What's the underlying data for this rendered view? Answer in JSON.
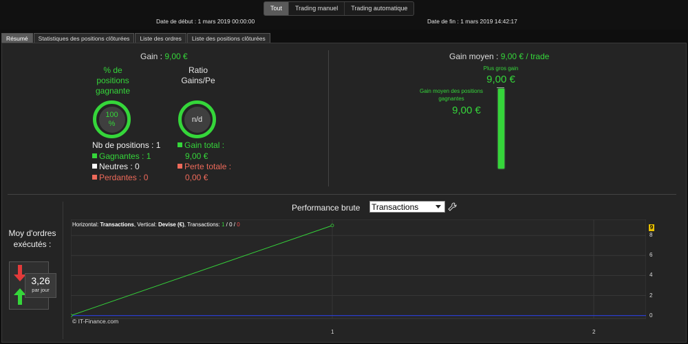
{
  "mode_tabs": [
    "Tout",
    "Trading manuel",
    "Trading automatique"
  ],
  "date_start": "Date de début : 1 mars 2019 00:00:00",
  "date_end": "Date de fin : 1 mars 2019 14:42:17",
  "section_tabs": [
    "Résumé",
    "Statistiques des positions clôturées",
    "Liste des ordres",
    "Liste des positions clôturées"
  ],
  "summary": {
    "gain_label": "Gain :",
    "gain_value": "9,00 €",
    "pct_title": "% de positions gagnante",
    "pct_value": "100 %",
    "ratio_title": "Ratio Gains/Pe",
    "ratio_value": "n/d",
    "nb_positions": "Nb de positions : 1",
    "winners": "Gagnantes : 1",
    "neutrals": "Neutres : 0",
    "losers": "Perdantes : 0",
    "total_gain_label": "Gain total :",
    "total_gain_value": "9,00 €",
    "total_loss_label": "Perte totale :",
    "total_loss_value": "0,00 €",
    "colors": {
      "win": "#35d63a",
      "neutral": "#ffffff",
      "loss": "#ee6a5a"
    }
  },
  "avg_gain": {
    "label": "Gain moyen :",
    "value": "9,00 € / trade",
    "biggest_label": "Plus gros gain",
    "biggest_value": "9,00 €",
    "avg_win_label": "Gain moyen des positions gagnantes",
    "avg_win_value": "9,00 €"
  },
  "orders": {
    "title": "Moy d'ordres exécutés :",
    "value": "3,26",
    "unit": "par jour"
  },
  "performance": {
    "title": "Performance brute",
    "select_value": "Transactions",
    "info_prefix_h": "Horizontal: ",
    "info_h": "Transactions",
    "info_mid": ", Vertical: ",
    "info_v": "Devise (€)",
    "info_mid2": ", Transactions: ",
    "info_t1": "1",
    "info_sep1": " / ",
    "info_t2": "0",
    "info_sep2": " / ",
    "info_t3": "0",
    "copyright": "© IT-Finance.com",
    "last_value_badge": "9"
  },
  "chart_data": {
    "type": "line",
    "x": [
      0,
      1
    ],
    "series": [
      {
        "values": [
          0,
          9
        ],
        "color": "#35d63a"
      }
    ],
    "baseline": {
      "values": [
        0,
        0
      ],
      "color": "#2a3dcc"
    },
    "xticks": [
      "1",
      "2"
    ],
    "yticks": [
      "0",
      "2",
      "4",
      "6",
      "8"
    ],
    "xlim": [
      0,
      2.2
    ],
    "ylim": [
      -0.3,
      9.6
    ],
    "grid": true
  }
}
